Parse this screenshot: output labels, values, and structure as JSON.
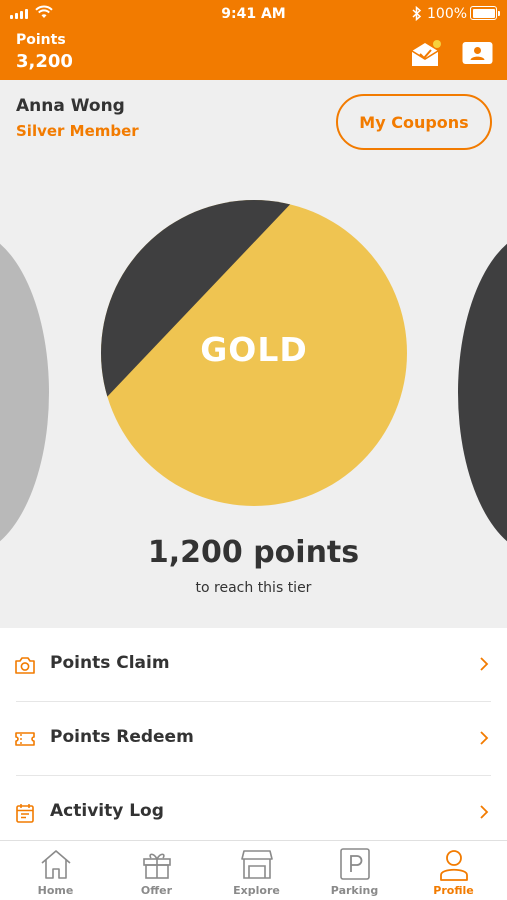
{
  "status_bar": {
    "time": "9:41 AM",
    "battery": "100%"
  },
  "header": {
    "points_label": "Points",
    "points_value": "3,200",
    "icons": [
      "mail-icon",
      "member-card-icon"
    ]
  },
  "profile": {
    "name": "Anna Wong",
    "tier": "Silver Member",
    "coupons_button": "My Coupons"
  },
  "tier_carousel": {
    "current_tier": "GOLD",
    "points_needed": "1,200 points",
    "points_caption": "to reach this tier"
  },
  "menu": [
    {
      "label": "Points Claim",
      "icon": "camera-icon"
    },
    {
      "label": "Points Redeem",
      "icon": "ticket-icon"
    },
    {
      "label": "Activity Log",
      "icon": "calendar-icon"
    }
  ],
  "tabs": [
    {
      "label": "Home",
      "icon": "home-icon"
    },
    {
      "label": "Offer",
      "icon": "gift-icon"
    },
    {
      "label": "Explore",
      "icon": "store-icon"
    },
    {
      "label": "Parking",
      "icon": "parking-icon"
    },
    {
      "label": "Profile",
      "icon": "profile-icon",
      "active": true
    }
  ],
  "colors": {
    "brand": "#f27b00",
    "gold": "#efc451",
    "dark": "#3f3f40",
    "silver": "#b9b9b9",
    "background": "#efefef"
  }
}
